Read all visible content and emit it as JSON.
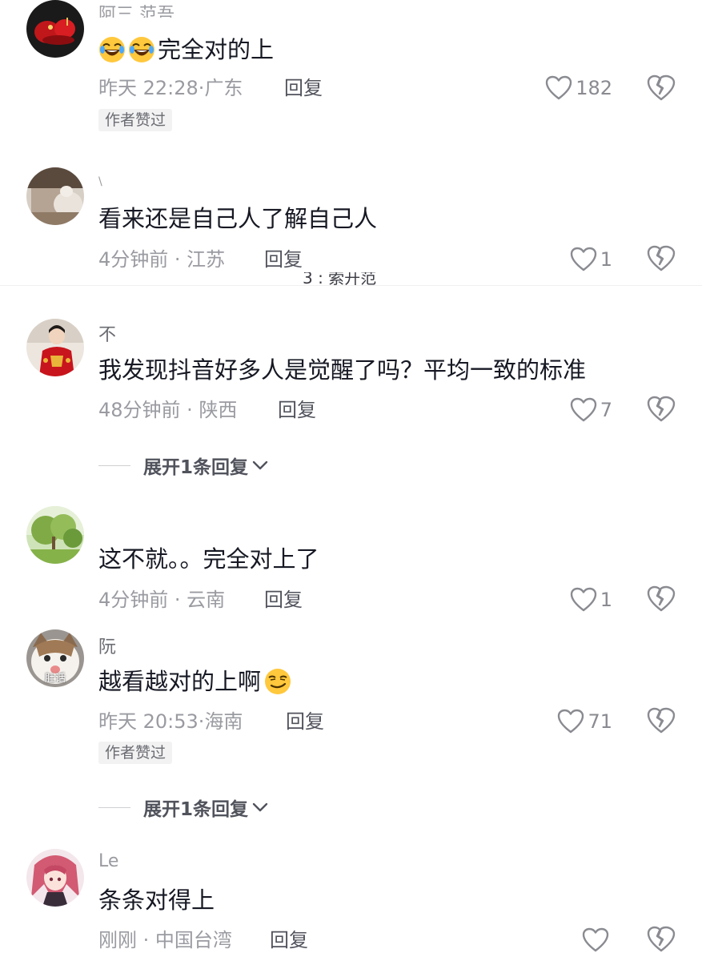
{
  "comments": [
    {
      "username": "阿三 范吾",
      "text": "完全对的上",
      "time": "昨天 22:28",
      "location": "广东",
      "reply": "回复",
      "likes": "182",
      "author_badge": "作者赞过",
      "emoji_leading": [
        "grin-laugh-emoji",
        "grin-laugh-emoji"
      ]
    },
    {
      "username": "\\",
      "text": "看来还是自己人了解自己人",
      "time": "4分钟前",
      "location": "江苏",
      "reply": "回复",
      "likes": "1"
    },
    {
      "username": "不",
      "text": "我发现抖音好多人是觉醒了吗？平均一致的标准",
      "time": "48分钟前",
      "location": "陕西",
      "reply": "回复",
      "likes": "7",
      "expand": "展开1条回复"
    },
    {
      "username": "",
      "text": "这不就。。完全对上了",
      "time": "4分钟前",
      "location": "云南",
      "reply": "回复",
      "likes": "1"
    },
    {
      "username": "阮",
      "avatar_caption": "肚话",
      "text": "越看越对的上啊",
      "time": "昨天 20:53",
      "location": "海南",
      "reply": "回复",
      "likes": "71",
      "author_badge": "作者赞过",
      "expand": "展开1条回复",
      "emoji_trailing": "smirk-emoji"
    },
    {
      "username": "Le",
      "text": "条条对得上",
      "time": "刚刚",
      "location": "中国台湾",
      "reply": "回复",
      "likes": ""
    }
  ],
  "stray_text": "3 : 索开范",
  "colors": {
    "primary_text": "#161823",
    "secondary_text": "#9a9ba1",
    "badge_bg": "#f2f2f3"
  }
}
